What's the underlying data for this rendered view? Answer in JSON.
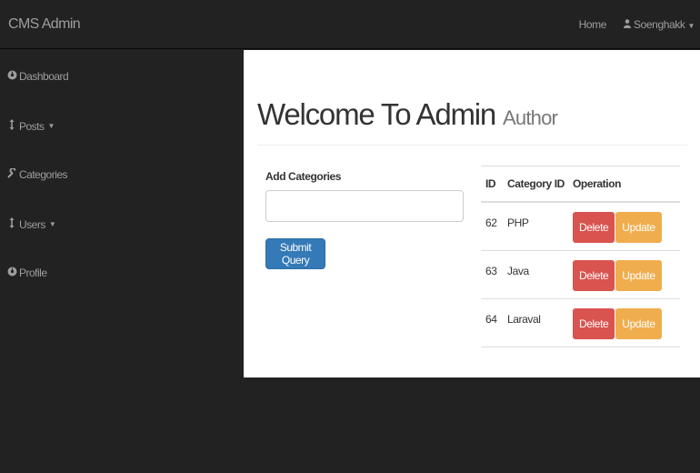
{
  "navbar": {
    "brand": "CMS Admin",
    "home_label": "Home",
    "user_label": "Soenghakk"
  },
  "sidebar": {
    "items": [
      {
        "label": "Dashboard",
        "icon": "dashboard-icon",
        "has_caret": false
      },
      {
        "label": "Posts",
        "icon": "posts-icon",
        "has_caret": true
      },
      {
        "label": "Categories",
        "icon": "wrench-icon",
        "has_caret": false
      },
      {
        "label": "Users",
        "icon": "users-icon",
        "has_caret": true
      },
      {
        "label": "Profile",
        "icon": "profile-icon",
        "has_caret": false
      }
    ]
  },
  "main": {
    "title": "Welcome To Admin",
    "subtitle": "Author",
    "form": {
      "label": "Add Categories",
      "input_value": "",
      "submit_label": "Submit Query"
    },
    "table": {
      "headers": [
        "ID",
        "Category ID",
        "Operation"
      ],
      "rows": [
        {
          "id": "62",
          "name": "PHP"
        },
        {
          "id": "63",
          "name": "Java"
        },
        {
          "id": "64",
          "name": "Laraval"
        }
      ],
      "delete_label": "Delete",
      "update_label": "Update"
    }
  },
  "colors": {
    "navbar_bg": "#222222",
    "primary": "#337ab7",
    "danger": "#d9534f",
    "warning": "#f0ad4e"
  }
}
